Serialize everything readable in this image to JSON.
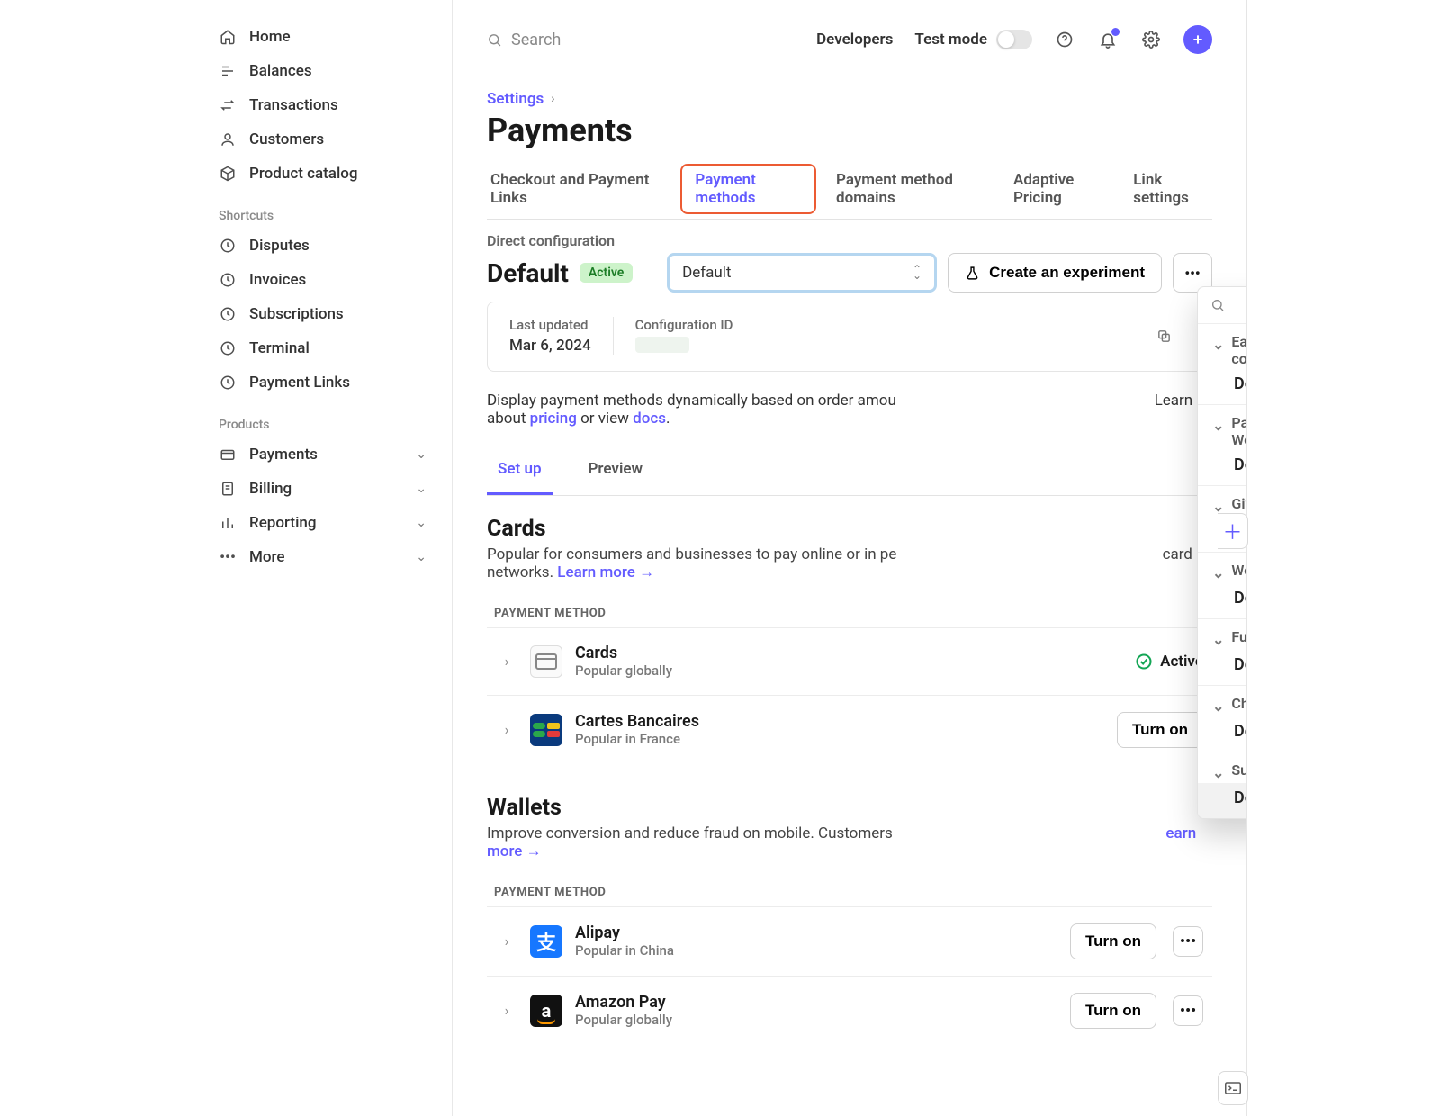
{
  "top": {
    "search_placeholder": "Search",
    "developers": "Developers",
    "test_mode": "Test mode"
  },
  "sidebar": {
    "main": [
      {
        "label": "Home"
      },
      {
        "label": "Balances"
      },
      {
        "label": "Transactions"
      },
      {
        "label": "Customers"
      },
      {
        "label": "Product catalog"
      }
    ],
    "shortcuts_heading": "Shortcuts",
    "shortcuts": [
      {
        "label": "Disputes"
      },
      {
        "label": "Invoices"
      },
      {
        "label": "Subscriptions"
      },
      {
        "label": "Terminal"
      },
      {
        "label": "Payment Links"
      }
    ],
    "products_heading": "Products",
    "products": [
      {
        "label": "Payments"
      },
      {
        "label": "Billing"
      },
      {
        "label": "Reporting"
      },
      {
        "label": "More"
      }
    ]
  },
  "crumb": "Settings",
  "page_title": "Payments",
  "tabs": [
    "Checkout and Payment Links",
    "Payment methods",
    "Payment method domains",
    "Adaptive Pricing",
    "Link settings"
  ],
  "config": {
    "section_label": "Direct configuration",
    "name": "Default",
    "status": "Active",
    "select_value": "Default",
    "experiment_btn": "Create an experiment"
  },
  "meta": {
    "last_updated_label": "Last updated",
    "last_updated": "Mar 6, 2024",
    "config_id_label": "Configuration ID"
  },
  "desc": {
    "prefix": "Display payment methods dynamically based on order amou",
    "mid": "Learn about ",
    "pricing": "pricing",
    "or": " or view ",
    "docs": "docs",
    "suffix": "."
  },
  "subtabs": [
    "Set up",
    "Preview"
  ],
  "cards": {
    "title": "Cards",
    "desc_prefix": "Popular for consumers and businesses to pay online or in pe",
    "desc_mid": "card networks. ",
    "learn_more": "Learn more →",
    "pm_header": "PAYMENT METHOD",
    "rows": [
      {
        "name": "Cards",
        "sub": "Popular globally",
        "status": "Active"
      },
      {
        "name": "Cartes Bancaires",
        "sub": "Popular in France",
        "turn_on": "Turn on"
      }
    ]
  },
  "wallets": {
    "title": "Wallets",
    "desc_prefix": "Improve conversion and reduce fraud on mobile. Customers",
    "learn_more": "earn more →",
    "pm_header": "PAYMENT METHOD",
    "rows": [
      {
        "name": "Alipay",
        "sub": "Popular in China",
        "turn_on": "Turn on"
      },
      {
        "name": "Amazon Pay",
        "sub": "Popular globally",
        "turn_on": "Turn on"
      }
    ]
  },
  "popover": {
    "groups": [
      {
        "h": "Easy Digital Downloads configurations",
        "opt": "Default"
      },
      {
        "h": "Payment Plugins for Stripe WooCommerce configurations",
        "opt": "Default"
      },
      {
        "h": "GiveWP configurations",
        "opt": "Default"
      },
      {
        "h": "WooCommerce Inc. configurations",
        "opt": "Default"
      },
      {
        "h": "FunnelKit configurations",
        "opt": "Default"
      },
      {
        "h": "Checkout Plugins configurations",
        "opt": "Default"
      },
      {
        "h": "SureCart configurations",
        "opt": "Default"
      }
    ]
  }
}
